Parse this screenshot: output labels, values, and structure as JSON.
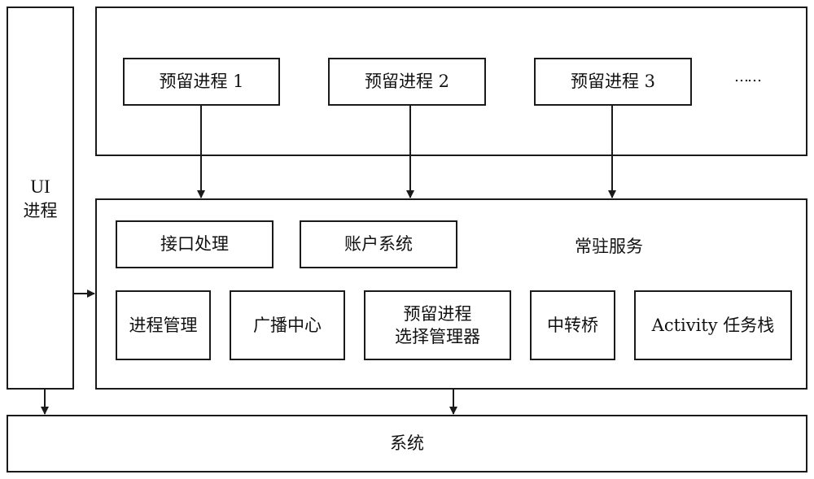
{
  "ui_process": {
    "line1": "UI",
    "line2": "进程"
  },
  "reserved_processes": {
    "items": [
      {
        "label": "预留进程 1"
      },
      {
        "label": "预留进程 2"
      },
      {
        "label": "预留进程 3"
      }
    ],
    "ellipsis": "……"
  },
  "resident_service": {
    "title": "常驻服务",
    "row1": [
      {
        "label": "接口处理"
      },
      {
        "label": "账户系统"
      }
    ],
    "row2": [
      {
        "label": "进程管理"
      },
      {
        "label": "广播中心"
      },
      {
        "label": "预留进程\n选择管理器",
        "line1": "预留进程",
        "line2": "选择管理器"
      },
      {
        "label": "中转桥"
      },
      {
        "label": "Activity 任务栈"
      }
    ]
  },
  "system": {
    "label": "系统"
  },
  "colors": {
    "stroke": "#1a1a1a",
    "background": "#ffffff"
  }
}
